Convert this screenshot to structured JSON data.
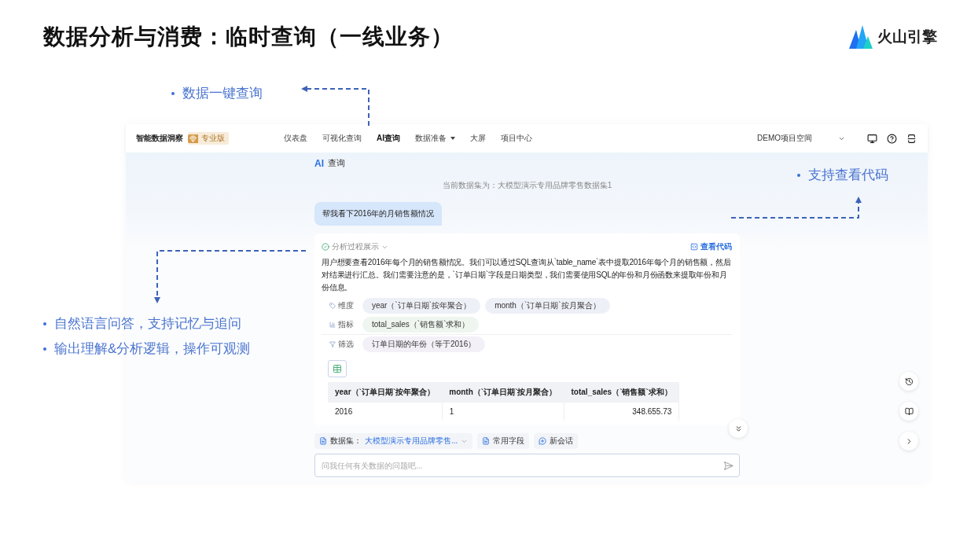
{
  "slide": {
    "title": "数据分析与消费：临时查询（一线业务）",
    "logo": "火山引擎"
  },
  "callouts": [
    {
      "text": "数据一键查询"
    },
    {
      "text": "支持查看代码"
    },
    {
      "text": "自然语言问答，支持记忆与追问"
    },
    {
      "text": "输出理解&分析逻辑，操作可观测"
    }
  ],
  "app": {
    "brand": "智能数据洞察",
    "edition": "专业版",
    "nav": [
      {
        "label": "仪表盘",
        "selected": false,
        "dropdown": false
      },
      {
        "label": "可视化查询",
        "selected": false,
        "dropdown": false
      },
      {
        "label": "AI查询",
        "selected": true,
        "dropdown": false
      },
      {
        "label": "数据准备",
        "selected": false,
        "dropdown": true
      },
      {
        "label": "大屏",
        "selected": false,
        "dropdown": false
      },
      {
        "label": "项目中心",
        "selected": false,
        "dropdown": false
      }
    ],
    "workspace": "DEMO项目空间",
    "page_title": {
      "badge": "AI",
      "text": "查询"
    },
    "dataset_line": "当前数据集为：大模型演示专用品牌零售数据集1",
    "user_message": "帮我看下2016年的月销售额情况",
    "answer": {
      "process_label": "分析过程展示",
      "view_code": "查看代码",
      "text": "用户想要查看2016年每个月的销售额情况。我们可以通过SQL查询从`table_name`表中提取2016年每个月的销售额，然后对结果进行汇总。我们需要注意的是，`订单日期`字段是日期类型，我们需要使用SQL的年份和月份函数来提取年份和月份信息。",
      "fields": [
        {
          "kind": "dimension",
          "label": "维度",
          "chips": [
            "year（`订单日期`按年聚合）",
            "month（`订单日期`按月聚合）"
          ]
        },
        {
          "kind": "metric",
          "label": "指标",
          "chips": [
            "total_sales（`销售额`求和）"
          ]
        },
        {
          "kind": "filter",
          "label": "筛选",
          "chips": [
            "订单日期的年份（等于2016）"
          ]
        }
      ],
      "table": {
        "columns": [
          "year（`订单日期`按年聚合）",
          "month（`订单日期`按月聚合）",
          "total_sales（`销售额`求和）"
        ],
        "rows": [
          [
            "2016",
            "1",
            "348.655.73"
          ]
        ]
      }
    },
    "toolbar": {
      "dataset_label": "数据集：",
      "dataset_value": "大模型演示专用品牌零售...",
      "fields": "常用字段",
      "new_chat": "新会话"
    },
    "input": {
      "placeholder": "问我任何有关数据的问题吧..."
    }
  }
}
